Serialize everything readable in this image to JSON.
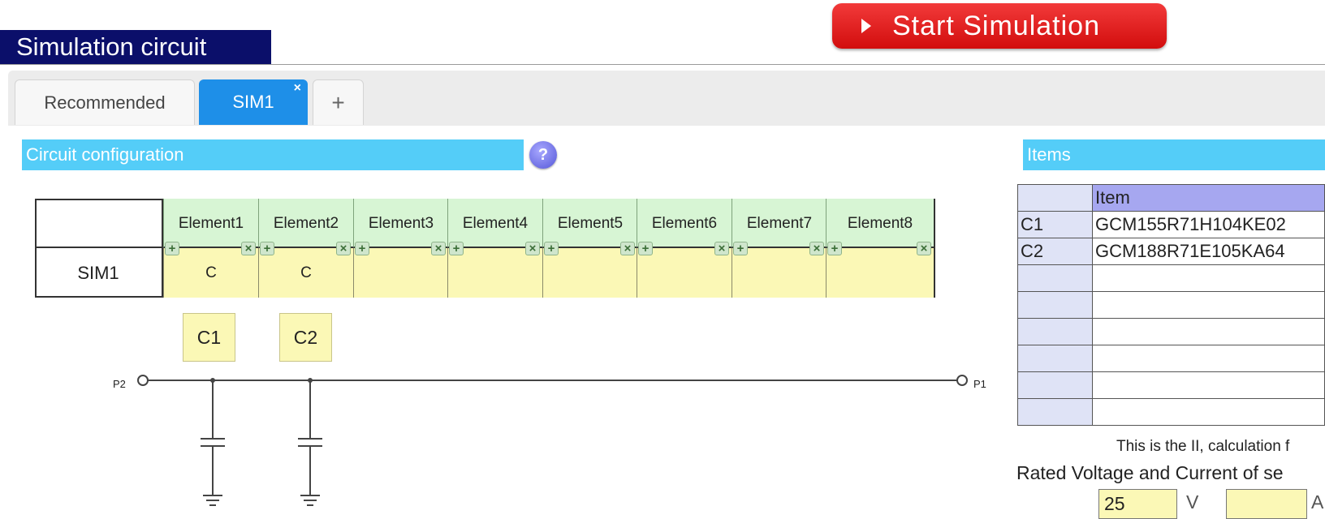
{
  "header": {
    "title": "Simulation circuit",
    "start_button": "Start Simulation"
  },
  "tabs": [
    {
      "label": "Recommended",
      "active": false
    },
    {
      "label": "SIM1",
      "active": true,
      "close": "×"
    },
    {
      "label": "+"
    }
  ],
  "circuit_config": {
    "title": "Circuit configuration",
    "help": "?",
    "row_label": "SIM1",
    "elements": [
      "Element1",
      "Element2",
      "Element3",
      "Element4",
      "Element5",
      "Element6",
      "Element7",
      "Element8"
    ],
    "cells": [
      "C",
      "C",
      "",
      "",
      "",
      "",
      "",
      ""
    ],
    "add_symbol": "+",
    "remove_symbol": "×"
  },
  "components": [
    "C1",
    "C2"
  ],
  "ports": {
    "left": "P2",
    "right": "P1"
  },
  "items": {
    "title": "Items",
    "header": "Item",
    "rows": [
      {
        "label": "C1",
        "value": "GCM155R71H104KE02"
      },
      {
        "label": "C2",
        "value": "GCM188R71E105KA64"
      },
      {
        "label": "",
        "value": ""
      },
      {
        "label": "",
        "value": ""
      },
      {
        "label": "",
        "value": ""
      },
      {
        "label": "",
        "value": ""
      },
      {
        "label": "",
        "value": ""
      },
      {
        "label": "",
        "value": ""
      }
    ]
  },
  "calc_note": "This is the II, calculation f",
  "rated": {
    "title": "Rated Voltage and Current of se",
    "voltage": "25",
    "voltage_unit": "V",
    "current": "",
    "current_unit": "A"
  },
  "colors": {
    "title_bar": "#0b0f6a",
    "start_button": "#e01b1b",
    "active_tab": "#1e8fe8",
    "section_bar": "#54cdf8",
    "element_header": "#d7f5d4",
    "element_cell": "#fbf8b6",
    "items_header": "#a6a7f0"
  }
}
